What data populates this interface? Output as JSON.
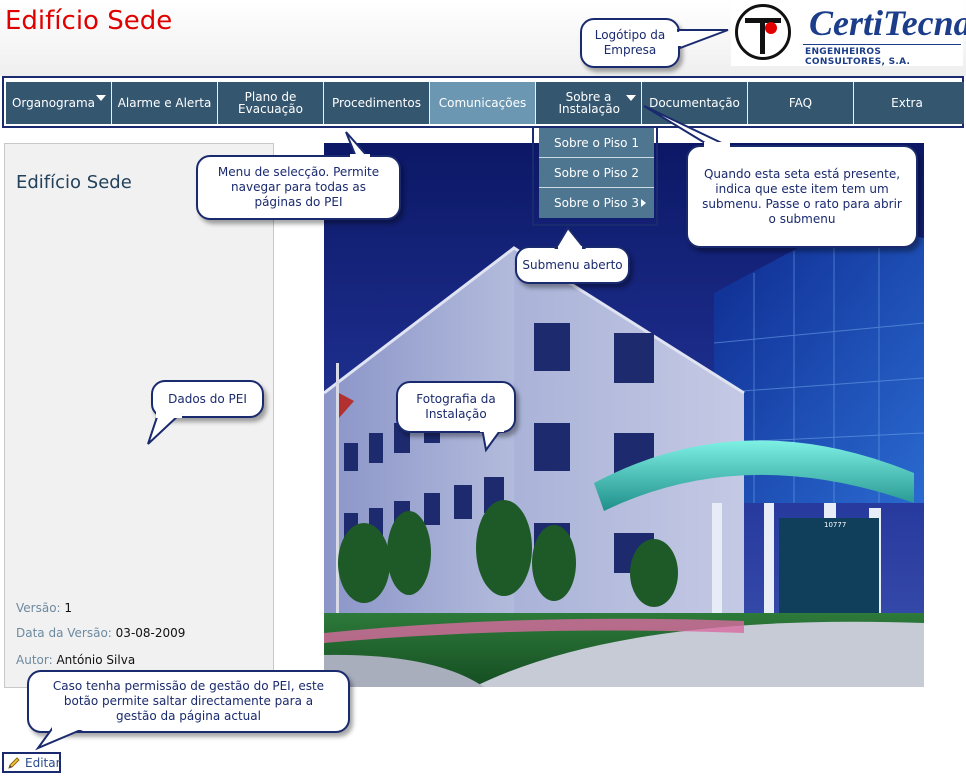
{
  "header": {
    "title": "Edifício Sede",
    "logo": {
      "name": "CertiTecna",
      "subtitle": "ENGENHEIROS CONSULTORES, S.A."
    }
  },
  "nav": {
    "items": [
      {
        "label": "Organograma",
        "has_submenu": true,
        "active": false
      },
      {
        "label": "Alarme e Alerta",
        "has_submenu": false,
        "active": false
      },
      {
        "label": "Plano de Evacuação",
        "has_submenu": false,
        "active": false
      },
      {
        "label": "Procedimentos",
        "has_submenu": false,
        "active": false
      },
      {
        "label": "Comunicações",
        "has_submenu": false,
        "active": true
      },
      {
        "label": "Sobre a Instalação",
        "has_submenu": true,
        "active": false
      },
      {
        "label": "Documentação",
        "has_submenu": false,
        "active": false
      },
      {
        "label": "FAQ",
        "has_submenu": false,
        "active": false
      },
      {
        "label": "Extra",
        "has_submenu": false,
        "active": false
      }
    ],
    "submenu": [
      {
        "label": "Sobre o Piso 1",
        "has_submenu": false
      },
      {
        "label": "Sobre o Piso 2",
        "has_submenu": false
      },
      {
        "label": "Sobre o Piso 3",
        "has_submenu": true
      }
    ]
  },
  "panel": {
    "title": "Edifício Sede",
    "version_label": "Versão:",
    "version_value": "1",
    "date_label": "Data da Versão:",
    "date_value": "03-08-2009",
    "author_label": "Autor:",
    "author_value": "António Silva"
  },
  "photo": {
    "building_number": "10777"
  },
  "callouts": {
    "logo": "Logótipo da Empresa",
    "menu": "Menu de selecção. Permite navegar para todas as páginas do PEI",
    "arrow": "Quando esta seta está presente, indica que este item tem um submenu. Passe o rato para abrir o submenu",
    "submenu": "Submenu aberto",
    "data": "Dados do PEI",
    "photo": "Fotografia da Instalação",
    "edit": "Caso tenha permissão de gestão do PEI, este botão permite saltar directamente para a gestão da página actual"
  },
  "edit_button": {
    "label": "Editar",
    "icon": "pencil-icon"
  },
  "colors": {
    "title_red": "#e00000",
    "nav_bg": "#34566f",
    "nav_active": "#6c97b3",
    "callout_border": "#1a2a6e"
  }
}
